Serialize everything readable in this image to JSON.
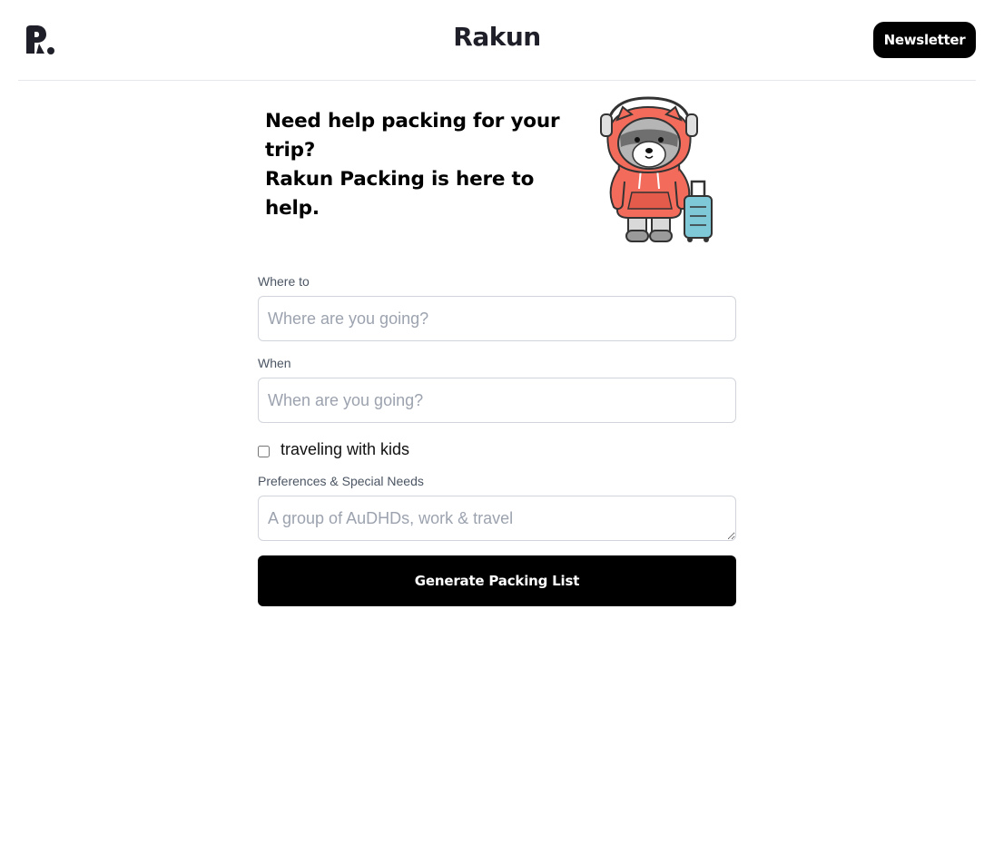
{
  "header": {
    "brand": "Rakun",
    "newsletter_label": "Newsletter",
    "logo_icon": "rakun-logo-icon"
  },
  "hero": {
    "line1": "Need help packing for your trip?",
    "line2": "Rakun Packing is here to help.",
    "illustration": "raccoon-mascot-with-suitcase"
  },
  "form": {
    "destination": {
      "label": "Where to",
      "placeholder": "Where are you going?",
      "value": ""
    },
    "date": {
      "label": "When",
      "placeholder": "When are you going?",
      "value": ""
    },
    "kids": {
      "label": "traveling with kids",
      "checked": false
    },
    "preferences": {
      "label": "Preferences & Special Needs",
      "placeholder": "A group of AuDHDs, work & travel",
      "value": ""
    },
    "submit_label": "Generate Packing List"
  },
  "colors": {
    "primary": "#000000",
    "border": "#d1d5db",
    "label": "#4b5563",
    "mascot_hoodie": "#f26b5b",
    "suitcase": "#7ec8d8"
  }
}
